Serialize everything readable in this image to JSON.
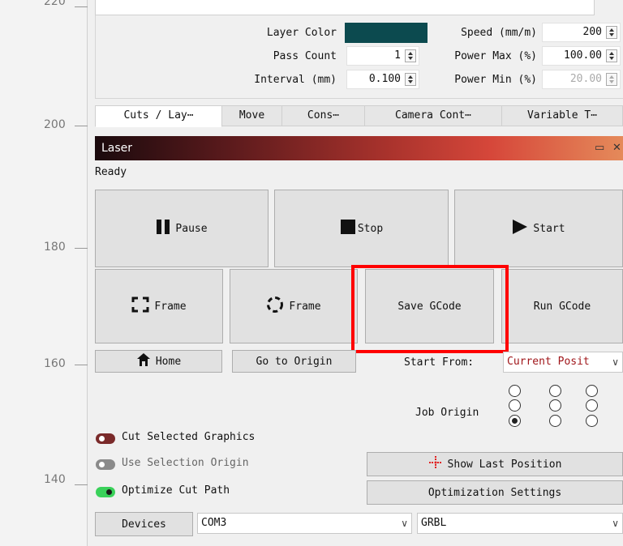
{
  "ruler": {
    "labels": [
      "220",
      "200",
      "180",
      "160",
      "140"
    ]
  },
  "layer": {
    "color_label": "Layer Color",
    "color_value": "#0c4a4f",
    "pass_count_label": "Pass Count",
    "pass_count_value": "1",
    "interval_label": "Interval (mm)",
    "interval_value": "0.100",
    "speed_label": "Speed (mm/m)",
    "speed_value": "200",
    "power_max_label": "Power Max (%)",
    "power_max_value": "100.00",
    "power_min_label": "Power Min (%)",
    "power_min_value": "20.00"
  },
  "tabs": [
    "Cuts / Lay⋯",
    "Move",
    "Cons⋯",
    "Camera Cont⋯",
    "Variable T⋯"
  ],
  "laser": {
    "title": "Laser",
    "float_icon": "restore-icon",
    "close_icon": "close-icon",
    "status": "Ready",
    "pause": "Pause",
    "stop": "Stop",
    "start": "Start",
    "frame_rect": "Frame",
    "frame_circle": "Frame",
    "save_gcode": "Save GCode",
    "run_gcode": "Run GCode",
    "home": "Home",
    "go_to_origin": "Go to Origin",
    "start_from_label": "Start From:",
    "start_from_value": "Current Posit",
    "job_origin_label": "Job Origin",
    "cut_selected": "Cut Selected Graphics",
    "use_selection_origin": "Use Selection Origin",
    "optimize_cut_path": "Optimize Cut Path",
    "show_last_position": "Show Last Position",
    "optimization_settings": "Optimization Settings",
    "devices": "Devices",
    "port": "COM3",
    "controller": "GRBL"
  },
  "colors": {
    "highlight": "#ff0000",
    "toggle_off_red": "#7a2a2a",
    "toggle_off_gray": "#8a8a8a",
    "toggle_on_green": "#3ad15a"
  }
}
